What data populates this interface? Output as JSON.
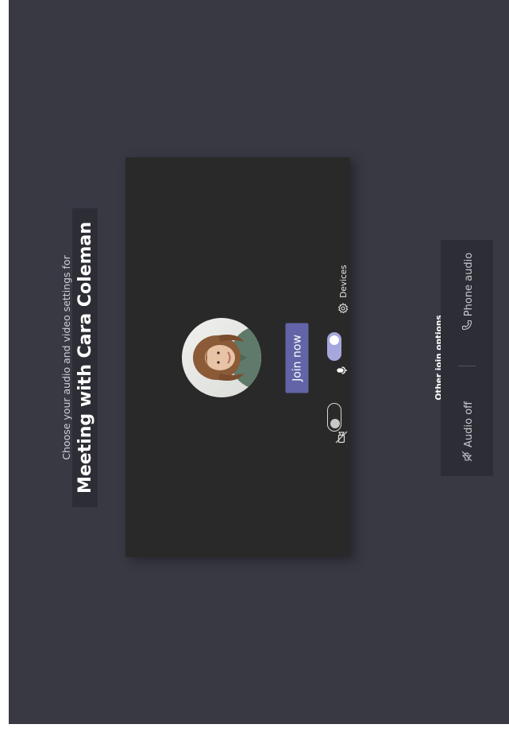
{
  "prejoin": {
    "subtitle": "Choose your audio and video settings for",
    "meeting_title": "Meeting with Cara Coleman",
    "join_label": "Join now",
    "camera_toggle_on": false,
    "mic_toggle_on": true,
    "devices_label": "Devices"
  },
  "other_options": {
    "heading": "Other join options",
    "audio_off_label": "Audio off",
    "phone_audio_label": "Phone audio"
  },
  "colors": {
    "background": "#393944",
    "preview": "#292929",
    "accent": "#6264a7",
    "toggle_on": "#a6a7dc"
  },
  "icons": [
    "camera-off-icon",
    "microphone-icon",
    "gear-icon",
    "speaker-off-icon",
    "phone-icon"
  ]
}
